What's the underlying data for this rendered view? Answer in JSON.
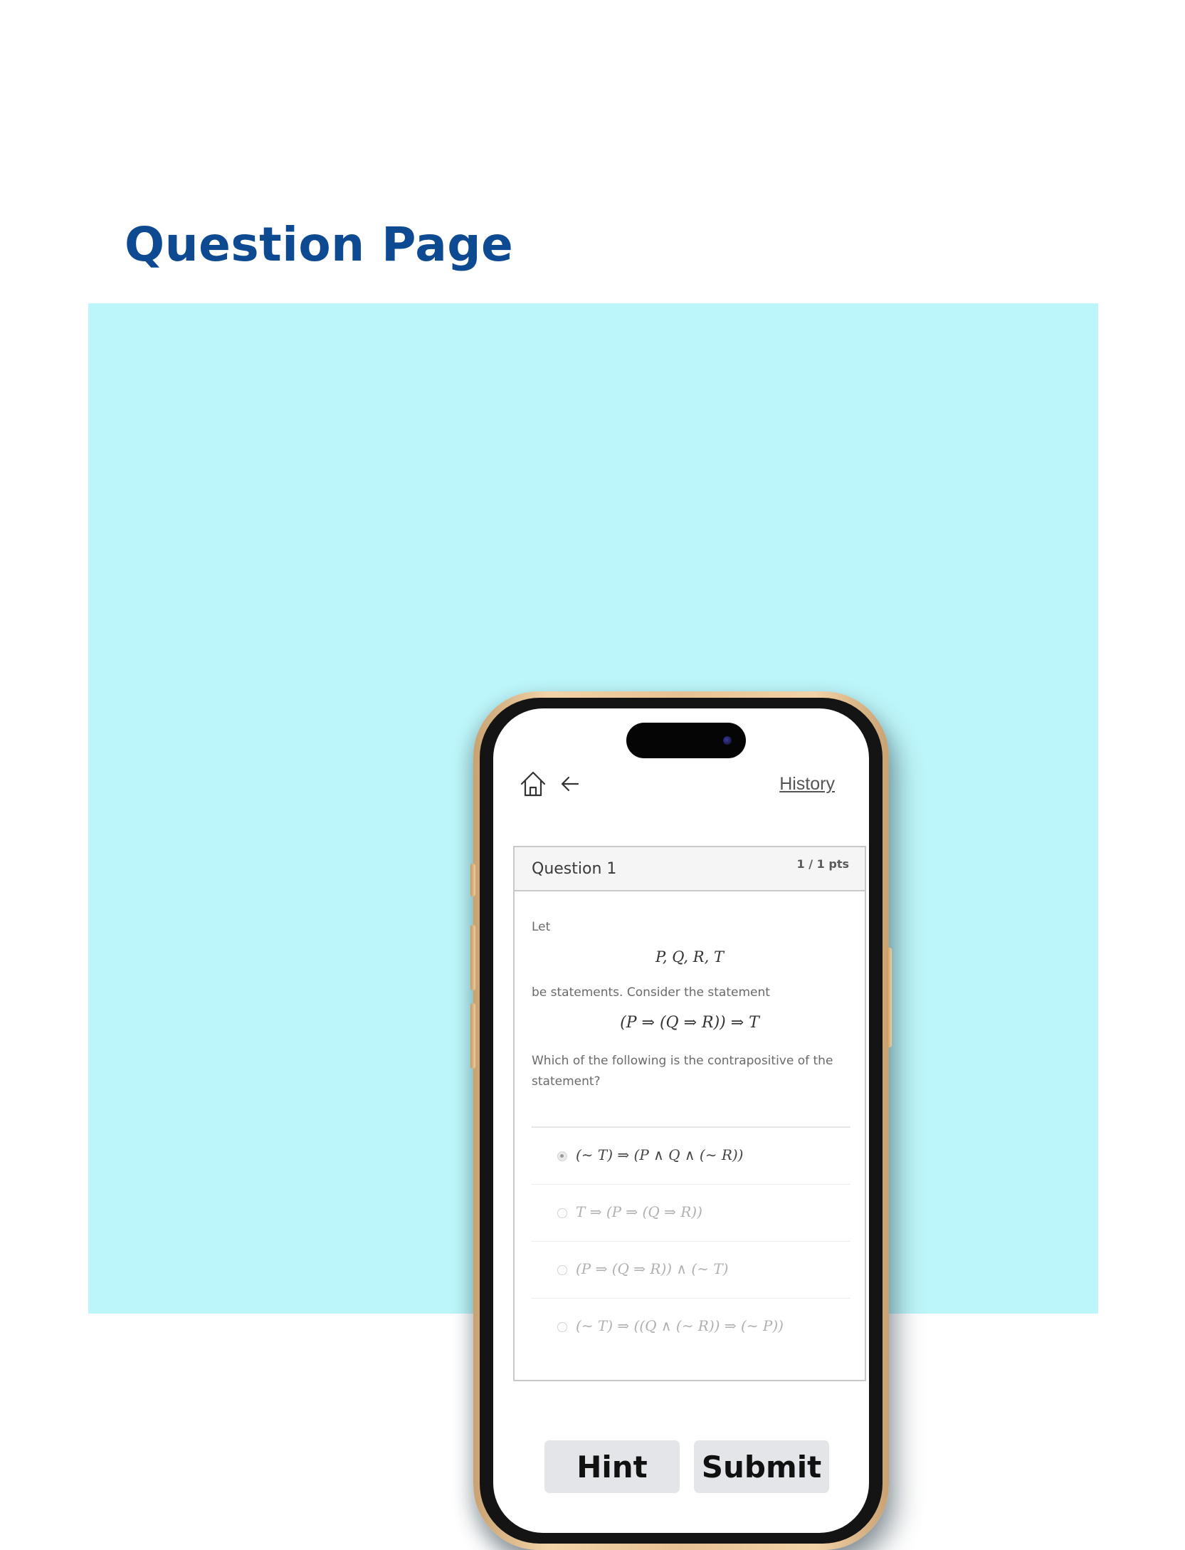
{
  "page": {
    "title": "Question Page"
  },
  "nav": {
    "home_icon": "home-icon",
    "back_icon": "arrow-left-icon",
    "history_label": "History"
  },
  "question": {
    "title": "Question 1",
    "points": "1 / 1 pts",
    "intro": "Let",
    "variables": "P, Q, R, T",
    "middle": "be statements. Consider the statement",
    "statement": "(P ⇒ (Q ⇒ R)) ⇒ T",
    "prompt": "Which of the following is the contrapositive of the statement?"
  },
  "answers": [
    {
      "label": "(∼ T) ⇒ (P ∧ Q ∧ (∼ R))",
      "selected": true
    },
    {
      "label": "T ⇒ (P ⇒ (Q ⇒ R))",
      "selected": false
    },
    {
      "label": "(P ⇒ (Q ⇒ R)) ∧ (∼ T)",
      "selected": false
    },
    {
      "label": "(∼ T) ⇒ ((Q ∧ (∼ R)) ⇒ (∼ P))",
      "selected": false
    }
  ],
  "actions": {
    "hint_label": "Hint",
    "submit_label": "Submit"
  },
  "colors": {
    "title": "#0d4a91",
    "panel_background": "#bdf6fa",
    "button_background": "#e3e5e8"
  }
}
